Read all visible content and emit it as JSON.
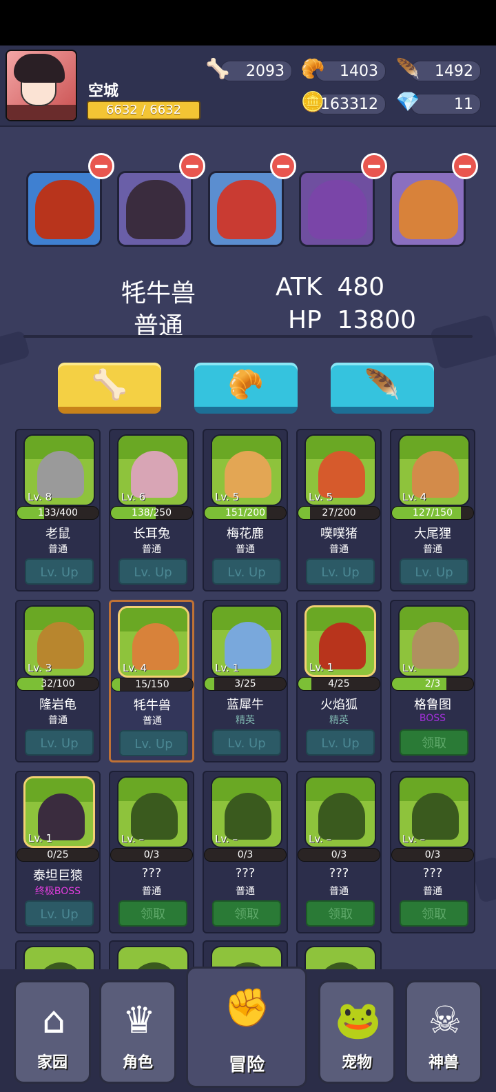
{
  "player": {
    "name": "空城",
    "exp": "6632 / 6632"
  },
  "resources": [
    {
      "icon": "bone-icon",
      "glyph": "🦴",
      "value": "2093"
    },
    {
      "icon": "horn-icon",
      "glyph": "🥐",
      "value": "1403"
    },
    {
      "icon": "wing-icon",
      "glyph": "🪶",
      "value": "1492"
    },
    {
      "icon": "gold-coin-icon",
      "glyph": "🪙",
      "value": "163312"
    },
    {
      "icon": "diamond-icon",
      "glyph": "💎",
      "value": "11"
    }
  ],
  "team": [
    {
      "name": "fire-fox",
      "color": "#b8341c"
    },
    {
      "name": "titan-ape",
      "color": "#3a2c3e"
    },
    {
      "name": "red-mantis",
      "color": "#c93b32"
    },
    {
      "name": "purple-creature",
      "color": "#7a45a8"
    },
    {
      "name": "yak",
      "color": "#d8823a"
    }
  ],
  "selected": {
    "name": "牦牛兽",
    "rank": "普通",
    "atk_label": "ATK",
    "atk": "480",
    "hp_label": "HP",
    "hp": "13800"
  },
  "feed_buttons": [
    {
      "icon": "bone-icon",
      "glyph": "🦴",
      "style": "yellow"
    },
    {
      "icon": "horn-icon",
      "glyph": "🥐",
      "style": "blue"
    },
    {
      "icon": "wing-icon",
      "glyph": "🪶",
      "style": "blue"
    }
  ],
  "pets": [
    {
      "name": "老鼠",
      "rank": "普通",
      "level": "Lv. 8",
      "progress": "133/400",
      "fill": 0.33,
      "action": "Lv. Up",
      "art_color": "#9a9a9a"
    },
    {
      "name": "长耳兔",
      "rank": "普通",
      "level": "Lv. 6",
      "progress": "138/250",
      "fill": 0.55,
      "action": "Lv. Up",
      "art_color": "#d8a5b5"
    },
    {
      "name": "梅花鹿",
      "rank": "普通",
      "level": "Lv. 5",
      "progress": "151/200",
      "fill": 0.76,
      "action": "Lv. Up",
      "art_color": "#e3a654"
    },
    {
      "name": "噗噗猪",
      "rank": "普通",
      "level": "Lv. 5",
      "progress": "27/200",
      "fill": 0.14,
      "action": "Lv. Up",
      "art_color": "#d65a2c"
    },
    {
      "name": "大尾狸",
      "rank": "普通",
      "level": "Lv. 4",
      "progress": "127/150",
      "fill": 0.85,
      "action": "Lv. Up",
      "art_color": "#d38b4a"
    },
    {
      "name": "隆岩龟",
      "rank": "普通",
      "level": "Lv. 3",
      "progress": "32/100",
      "fill": 0.32,
      "action": "Lv. Up",
      "art_color": "#b8862e"
    },
    {
      "name": "牦牛兽",
      "rank": "普通",
      "level": "Lv. 4",
      "progress": "15/150",
      "fill": 0.1,
      "action": "Lv. Up",
      "art_color": "#d8823a"
    },
    {
      "name": "蓝犀牛",
      "rank": "精英",
      "level": "Lv. 1",
      "progress": "3/25",
      "fill": 0.12,
      "action": "Lv. Up",
      "art_color": "#79a8dc"
    },
    {
      "name": "火焰狐",
      "rank": "精英",
      "level": "Lv. 1",
      "progress": "4/25",
      "fill": 0.16,
      "action": "Lv. Up",
      "art_color": "#b8341c"
    },
    {
      "name": "格鲁图",
      "rank": "BOSS",
      "level": "Lv.",
      "progress": "2/3",
      "fill": 0.67,
      "action": "领取",
      "art_color": "#b09060"
    },
    {
      "name": "泰坦巨猿",
      "rank": "终极BOSS",
      "level": "Lv. 1",
      "progress": "0/25",
      "fill": 0,
      "action": "Lv. Up",
      "art_color": "#3a2c3e"
    },
    {
      "name": "???",
      "rank": "普通",
      "level": "Lv. –",
      "progress": "0/3",
      "fill": 0,
      "action": "领取",
      "art_color": "#3a5a1e"
    },
    {
      "name": "???",
      "rank": "普通",
      "level": "Lv. –",
      "progress": "0/3",
      "fill": 0,
      "action": "领取",
      "art_color": "#3a5a1e"
    },
    {
      "name": "???",
      "rank": "普通",
      "level": "Lv. –",
      "progress": "0/3",
      "fill": 0,
      "action": "领取",
      "art_color": "#3a5a1e"
    },
    {
      "name": "???",
      "rank": "普通",
      "level": "Lv. –",
      "progress": "0/3",
      "fill": 0,
      "action": "领取",
      "art_color": "#3a5a1e"
    }
  ],
  "nav": [
    {
      "label": "家园",
      "icon": "home-icon",
      "glyph": "⌂"
    },
    {
      "label": "角色",
      "icon": "mask-icon",
      "glyph": "♛"
    },
    {
      "label": "冒险",
      "icon": "spiked-fist-icon",
      "glyph": "✊"
    },
    {
      "label": "宠物",
      "icon": "frog-icon",
      "glyph": "🐸"
    },
    {
      "label": "神兽",
      "icon": "dino-skull-icon",
      "glyph": "☠"
    }
  ]
}
